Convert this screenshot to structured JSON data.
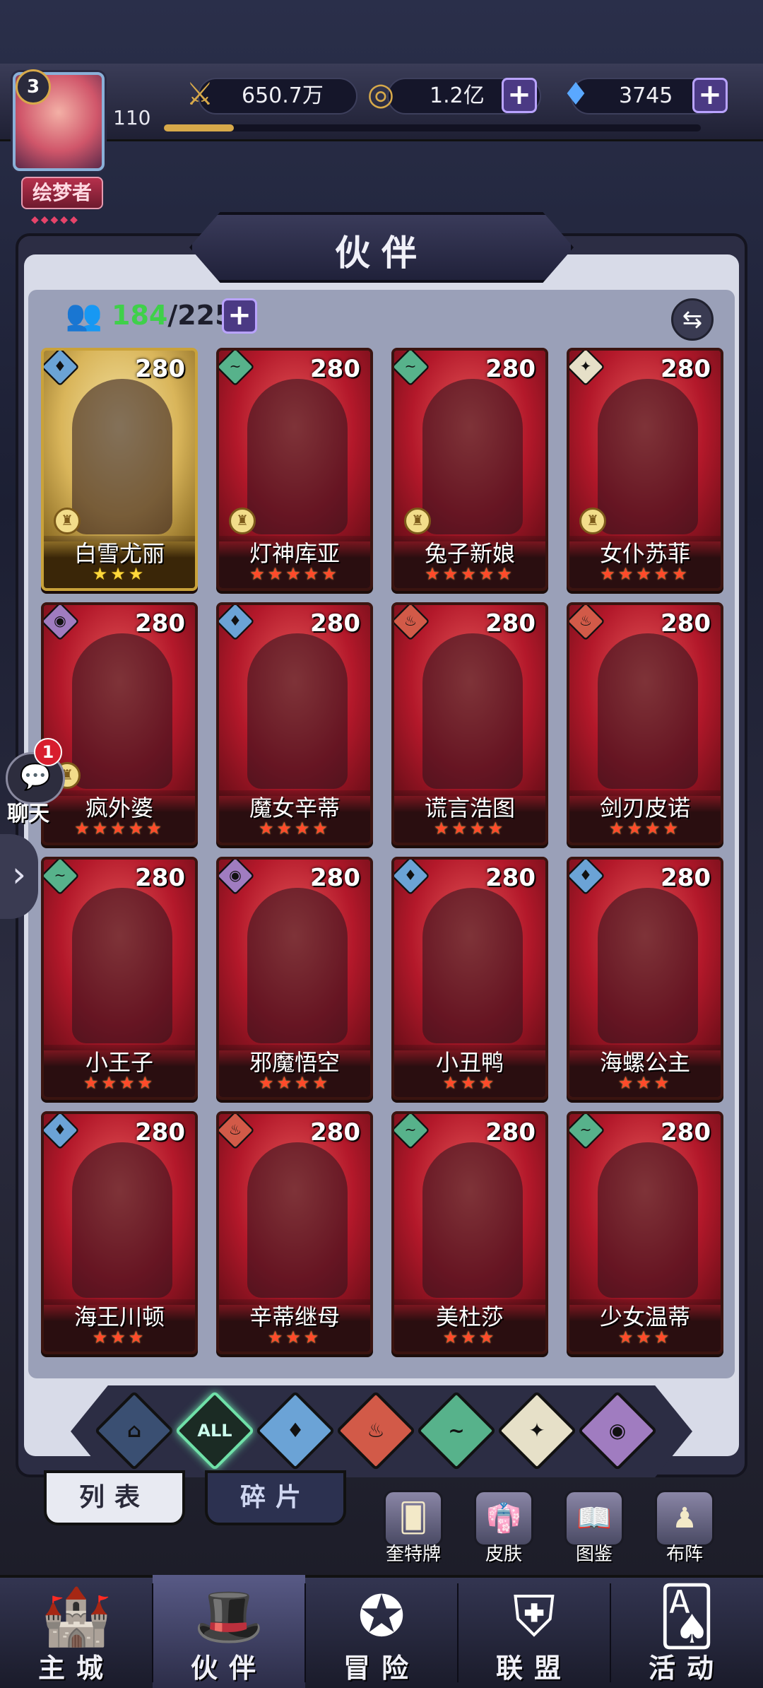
{
  "player": {
    "level": "3",
    "power_level": "110",
    "title": "绘梦者",
    "title_dots": "◆◆◆◆◆",
    "xp_fraction": 0.13
  },
  "resources": {
    "power": {
      "value": "650.7万",
      "icon": "sword-icon"
    },
    "gold": {
      "value": "1.2亿",
      "icon": "coin-icon"
    },
    "diamond": {
      "value": "3745",
      "icon": "diamond-icon"
    }
  },
  "panel": {
    "title": "伙伴",
    "count_owned": "184",
    "count_sep": "/",
    "count_total": "225"
  },
  "heroes": [
    {
      "name": "白雪尤丽",
      "level": "280",
      "element": "water",
      "stars": 3,
      "star_color": "gold",
      "crown": true
    },
    {
      "name": "灯神库亚",
      "level": "280",
      "element": "wind",
      "stars": 5,
      "star_color": "red",
      "crown": true
    },
    {
      "name": "兔子新娘",
      "level": "280",
      "element": "wind",
      "stars": 5,
      "star_color": "red",
      "crown": true
    },
    {
      "name": "女仆苏菲",
      "level": "280",
      "element": "light",
      "stars": 5,
      "star_color": "red",
      "crown": true
    },
    {
      "name": "疯外婆",
      "level": "280",
      "element": "dark",
      "stars": 5,
      "star_color": "red",
      "crown": true
    },
    {
      "name": "魔女辛蒂",
      "level": "280",
      "element": "water",
      "stars": 4,
      "star_color": "red",
      "crown": false
    },
    {
      "name": "谎言浩图",
      "level": "280",
      "element": "fire",
      "stars": 4,
      "star_color": "red",
      "crown": false
    },
    {
      "name": "剑刃皮诺",
      "level": "280",
      "element": "fire",
      "stars": 4,
      "star_color": "red",
      "crown": false
    },
    {
      "name": "小王子",
      "level": "280",
      "element": "wind",
      "stars": 4,
      "star_color": "red",
      "crown": false
    },
    {
      "name": "邪魔悟空",
      "level": "280",
      "element": "dark",
      "stars": 4,
      "star_color": "red",
      "crown": false
    },
    {
      "name": "小丑鸭",
      "level": "280",
      "element": "water",
      "stars": 3,
      "star_color": "red",
      "crown": false
    },
    {
      "name": "海螺公主",
      "level": "280",
      "element": "water",
      "stars": 3,
      "star_color": "red",
      "crown": false
    },
    {
      "name": "海王川顿",
      "level": "280",
      "element": "water",
      "stars": 3,
      "star_color": "red",
      "crown": false
    },
    {
      "name": "辛蒂继母",
      "level": "280",
      "element": "fire",
      "stars": 3,
      "star_color": "red",
      "crown": false
    },
    {
      "name": "美杜莎",
      "level": "280",
      "element": "wind",
      "stars": 3,
      "star_color": "red",
      "crown": false
    },
    {
      "name": "少女温蒂",
      "level": "280",
      "element": "wind",
      "stars": 3,
      "star_color": "red",
      "crown": false
    }
  ],
  "filters": [
    {
      "key": "base",
      "label": "⌂"
    },
    {
      "key": "all",
      "label": "ALL"
    },
    {
      "key": "water",
      "label": "♦"
    },
    {
      "key": "fire",
      "label": "♨"
    },
    {
      "key": "wind",
      "label": "~"
    },
    {
      "key": "light",
      "label": "✦"
    },
    {
      "key": "dark",
      "label": "◉"
    }
  ],
  "subtabs": {
    "list": "列表",
    "shards": "碎片"
  },
  "side_buttons": [
    {
      "label": "奎特牌",
      "icon": "card-pack-icon"
    },
    {
      "label": "皮肤",
      "icon": "outfit-icon"
    },
    {
      "label": "图鉴",
      "icon": "codex-icon"
    },
    {
      "label": "布阵",
      "icon": "formation-icon"
    }
  ],
  "chat": {
    "label": "聊天",
    "badge": "1"
  },
  "bottom_nav": [
    {
      "label": "主城",
      "icon": "castle-icon"
    },
    {
      "label": "伙伴",
      "icon": "hat-icon"
    },
    {
      "label": "冒险",
      "icon": "compass-icon"
    },
    {
      "label": "联盟",
      "icon": "shield-icon"
    },
    {
      "label": "活动",
      "icon": "cards-icon"
    }
  ],
  "colors": {
    "accent_gold": "#d7a94a",
    "owned_green": "#3fd04a",
    "card_red": "#b21d2b",
    "plus_purple": "#4b3a84"
  }
}
